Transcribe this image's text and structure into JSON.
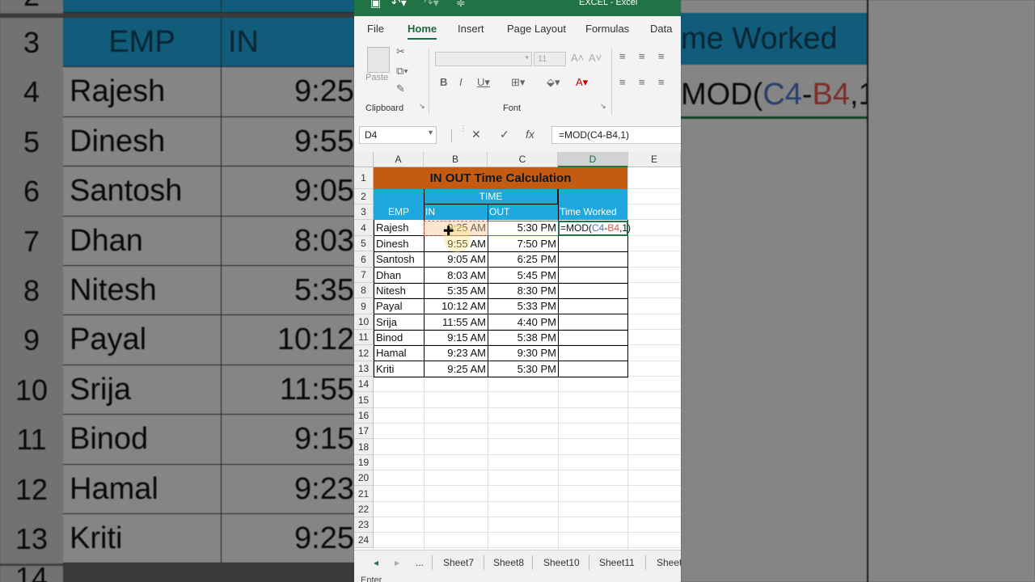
{
  "background_zoom": {
    "rows": [
      {
        "num": "3",
        "a": "EMP",
        "b": "IN"
      },
      {
        "num": "4",
        "a": "Rajesh",
        "b": "9:25"
      },
      {
        "num": "5",
        "a": "Dinesh",
        "b": "9:55"
      },
      {
        "num": "6",
        "a": "Santosh",
        "b": "9:05"
      },
      {
        "num": "7",
        "a": "Dhan",
        "b": "8:03"
      },
      {
        "num": "8",
        "a": "Nitesh",
        "b": "5:35"
      },
      {
        "num": "9",
        "a": "Payal",
        "b": "10:12"
      },
      {
        "num": "10",
        "a": "Srija",
        "b": "11:55"
      },
      {
        "num": "11",
        "a": "Binod",
        "b": "9:15"
      },
      {
        "num": "12",
        "a": "Hamal",
        "b": "9:23"
      },
      {
        "num": "13",
        "a": "Kriti",
        "b": "9:25"
      }
    ],
    "right_header": "me Worked",
    "right_formula_prefix": "MOD(",
    "right_formula_c4": "C4",
    "right_formula_minus": "-",
    "right_formula_b4": "B4",
    "right_formula_suffix": ",1)",
    "top_row_num": "2",
    "bottom_row_num": "14"
  },
  "titlebar": {
    "title": "EXCEL  -  Excel"
  },
  "ribbon": {
    "tabs": [
      "File",
      "Home",
      "Insert",
      "Page Layout",
      "Formulas",
      "Data"
    ],
    "active_tab": "Home",
    "paste_label": "Paste",
    "clipboard_label": "Clipboard",
    "font_label": "Font",
    "font_size": "11"
  },
  "formula_bar": {
    "name_box": "D4",
    "formula": "=MOD(C4-B4,1)"
  },
  "columns": [
    "A",
    "B",
    "C",
    "D",
    "E"
  ],
  "row_numbers": [
    "1",
    "2",
    "3",
    "4",
    "5",
    "6",
    "7",
    "8",
    "9",
    "10",
    "11",
    "12",
    "13",
    "14",
    "15",
    "16",
    "17",
    "18",
    "19",
    "20",
    "21",
    "22",
    "23",
    "24"
  ],
  "sheet": {
    "title": "IN OUT Time Calculation",
    "time_header": "TIME",
    "emp_header": "EMP",
    "in_header": "IN",
    "out_header": "OUT",
    "worked_header": "Time Worked",
    "d4_prefix": "=MOD(",
    "d4_c4": "C4",
    "d4_minus": "-",
    "d4_b4": "B4",
    "d4_suffix": ",1)",
    "rows": [
      {
        "emp": "Rajesh",
        "in": "9:25 AM",
        "out": "5:30 PM"
      },
      {
        "emp": "Dinesh",
        "in": "9:55 AM",
        "out": "7:50 PM"
      },
      {
        "emp": "Santosh",
        "in": "9:05 AM",
        "out": "6:25 PM"
      },
      {
        "emp": "Dhan",
        "in": "8:03 AM",
        "out": "5:45 PM"
      },
      {
        "emp": "Nitesh",
        "in": "5:35 AM",
        "out": "8:30 PM"
      },
      {
        "emp": "Payal",
        "in": "10:12 AM",
        "out": "5:33 PM"
      },
      {
        "emp": "Srija",
        "in": "11:55 AM",
        "out": "4:40 PM"
      },
      {
        "emp": "Binod",
        "in": "9:15 AM",
        "out": "5:38 PM"
      },
      {
        "emp": "Hamal",
        "in": "9:23 AM",
        "out": "9:30 PM"
      },
      {
        "emp": "Kriti",
        "in": "9:25 AM",
        "out": "5:30 PM"
      }
    ]
  },
  "sheet_tabs": {
    "ellipsis": "...",
    "tabs": [
      "Sheet7",
      "Sheet8",
      "Sheet10",
      "Sheet11",
      "Sheet"
    ]
  },
  "status": {
    "mode": "Enter"
  },
  "colors": {
    "excel_green": "#217346",
    "title_orange": "#c55a11",
    "header_blue": "#1ea8de",
    "ref_blue": "#4472c4",
    "ref_red": "#e0524b"
  }
}
